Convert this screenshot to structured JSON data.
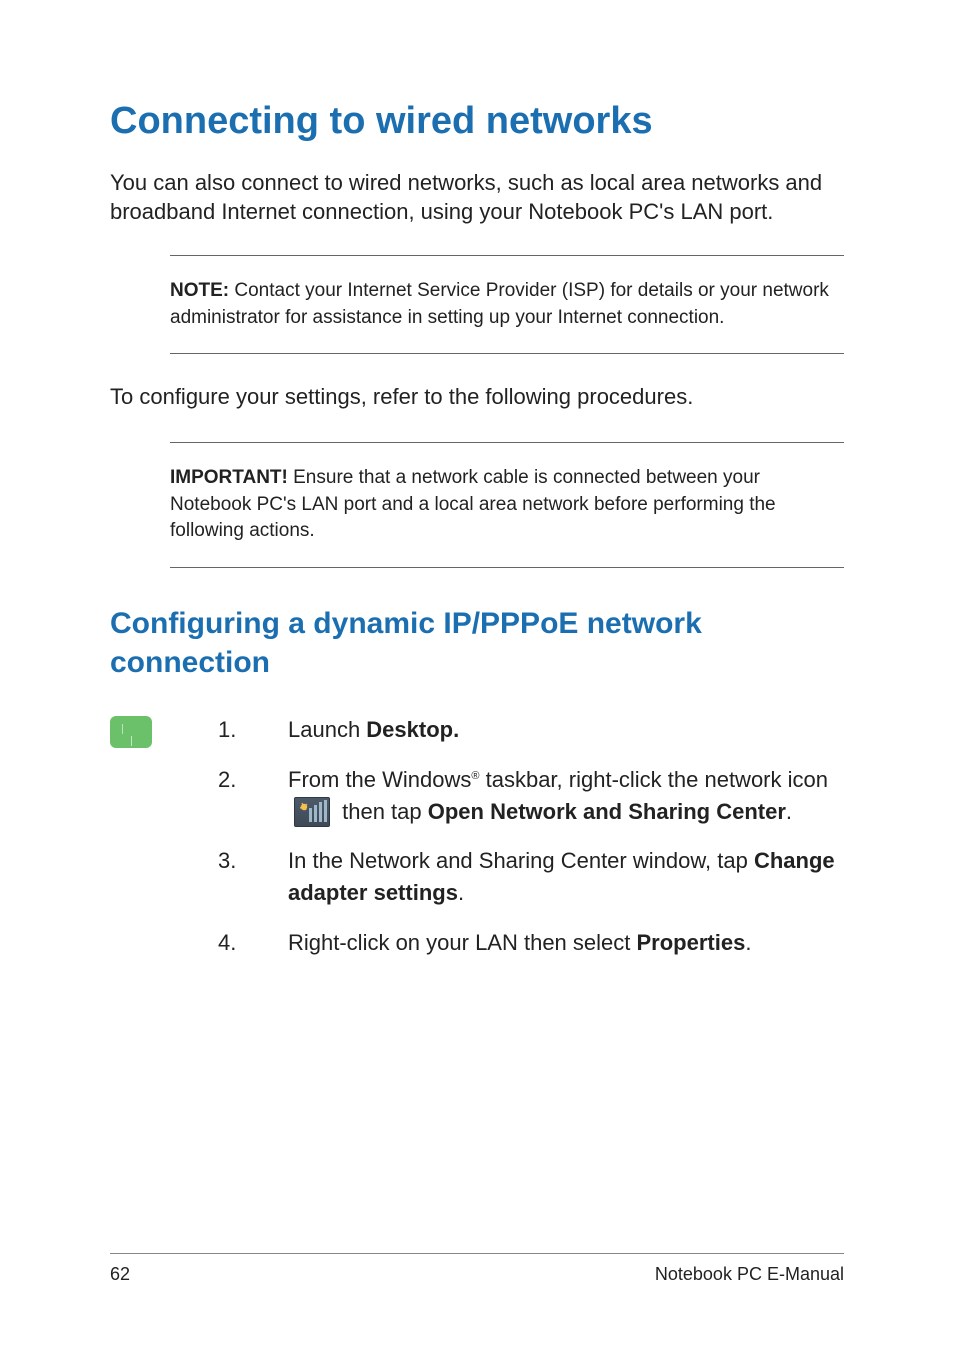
{
  "h1": "Connecting to wired networks",
  "intro": "You can also connect to wired networks, such as local area networks and broadband Internet connection, using your Notebook PC's LAN port.",
  "note": {
    "label": "NOTE:",
    "text": " Contact your Internet Service Provider (ISP) for details or your network administrator for assistance in setting up your Internet connection."
  },
  "mid": "To configure your settings, refer to the following procedures.",
  "important": {
    "label": "IMPORTANT!",
    "text": "  Ensure that a network cable is connected between your Notebook PC's LAN port and a local area network before performing the following actions."
  },
  "h2": "Configuring a dynamic IP/PPPoE network connection",
  "steps": {
    "s1": {
      "num": "1.",
      "pre": "Launch ",
      "bold": "Desktop."
    },
    "s2": {
      "num": "2.",
      "pre": "From the Windows",
      "reg": "®",
      "mid1": " taskbar, right-click the network icon ",
      "mid2": " then tap ",
      "bold": "Open Network and Sharing Center",
      "end": "."
    },
    "s3": {
      "num": "3.",
      "pre": "In the Network and Sharing Center window, tap ",
      "bold": "Change adapter settings",
      "end": "."
    },
    "s4": {
      "num": "4.",
      "pre": "Right-click on your LAN then select ",
      "bold": "Properties",
      "end": "."
    }
  },
  "footer": {
    "page": "62",
    "title": "Notebook PC E-Manual"
  }
}
